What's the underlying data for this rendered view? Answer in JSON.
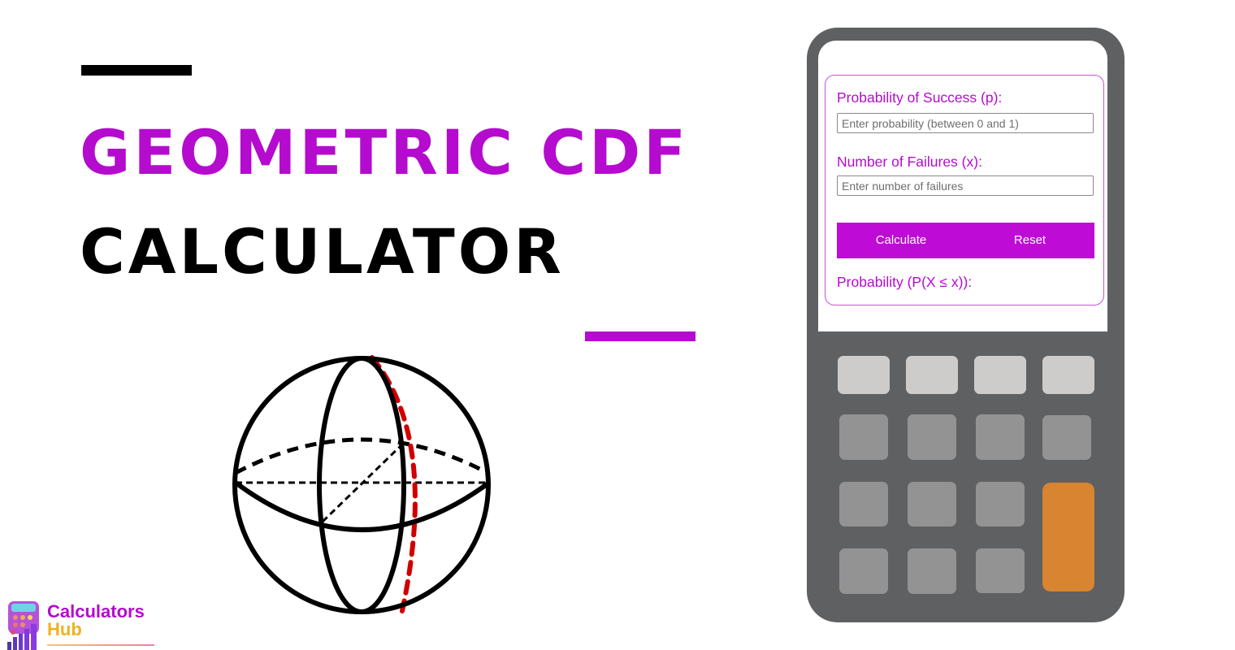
{
  "page": {
    "title_line1": "GEOMETRIC CDF",
    "title_line2": "CALCULATOR",
    "accent_color": "#b40bcf"
  },
  "logo": {
    "name_line1": "Calculators",
    "name_line2": "Hub",
    "icon": "calculator-chart-icon"
  },
  "illustration": {
    "icon": "sphere-icon"
  },
  "calculator": {
    "fields": [
      {
        "label": "Probability of Success (p):",
        "placeholder": "Enter probability (between 0 and 1)",
        "value": ""
      },
      {
        "label": "Number of Failures (x):",
        "placeholder": "Enter number of failures",
        "value": ""
      }
    ],
    "buttons": {
      "calculate": "Calculate",
      "reset": "Reset"
    },
    "result_label": "Probability (P(X ≤ x)):",
    "result_value": "",
    "keypad_colors": {
      "light": "#cdccca",
      "mid": "#939393",
      "equals": "#d98430",
      "body": "#5f6062"
    }
  }
}
